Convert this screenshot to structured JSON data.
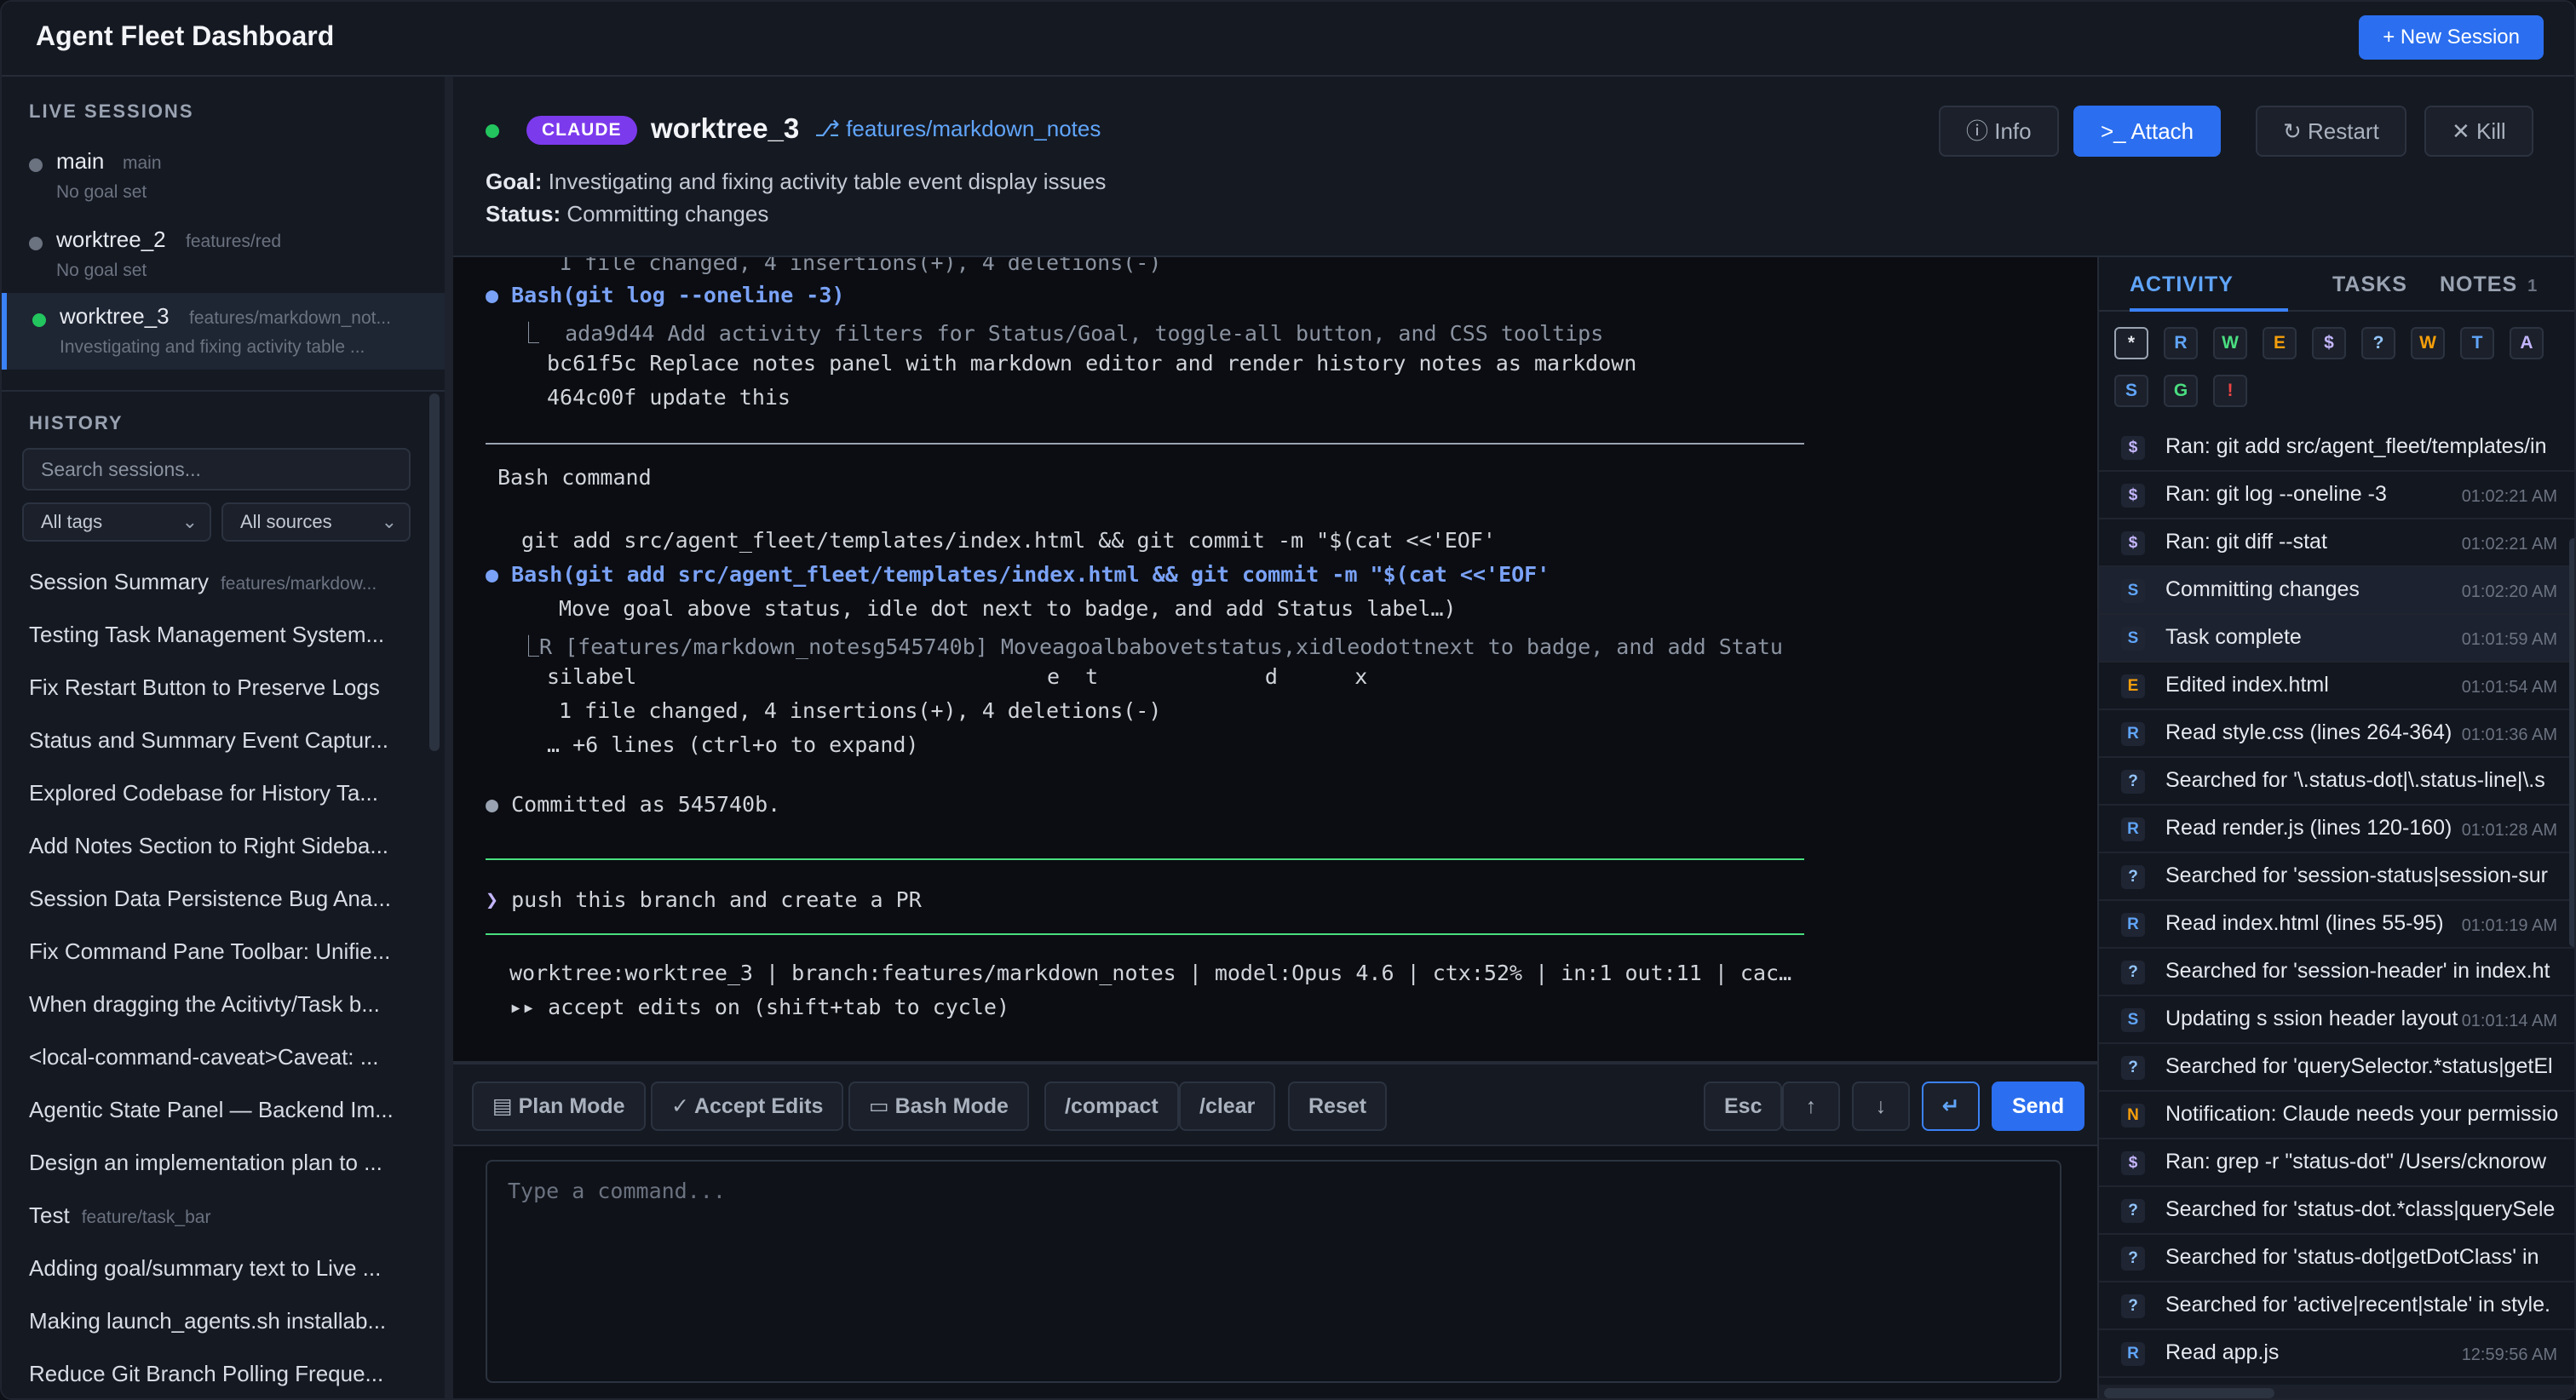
{
  "app": {
    "title": "Agent Fleet Dashboard",
    "new_session": "+ New Session"
  },
  "sidebar": {
    "live_heading": "LIVE SESSIONS",
    "live": [
      {
        "name": "main",
        "branch": "main",
        "goal": "No goal set"
      },
      {
        "name": "worktree_2",
        "branch": "features/red",
        "goal": "No goal set"
      },
      {
        "name": "worktree_3",
        "branch": "features/markdown_not...",
        "goal": "Investigating and fixing activity table ..."
      }
    ],
    "history_heading": "HISTORY",
    "search_placeholder": "Search sessions...",
    "tags_select": "All tags",
    "sources_select": "All sources",
    "history": [
      {
        "title": "Session Summary",
        "tag": "features/markdow..."
      },
      {
        "title": "Testing Task Management System...",
        "tag": ""
      },
      {
        "title": "Fix Restart Button to Preserve Logs",
        "tag": ""
      },
      {
        "title": "Status and Summary Event Captur...",
        "tag": ""
      },
      {
        "title": "Explored Codebase for History Ta...",
        "tag": ""
      },
      {
        "title": "Add Notes Section to Right Sideba...",
        "tag": ""
      },
      {
        "title": "Session Data Persistence Bug Ana...",
        "tag": ""
      },
      {
        "title": "Fix Command Pane Toolbar: Unifie...",
        "tag": ""
      },
      {
        "title": "When dragging the Acitivty/Task b...",
        "tag": ""
      },
      {
        "title": "<local-command-caveat>Caveat: ...",
        "tag": ""
      },
      {
        "title": "Agentic State Panel — Backend Im...",
        "tag": ""
      },
      {
        "title": "Design an implementation plan to ...",
        "tag": ""
      },
      {
        "title": "Test",
        "tag": "feature/task_bar"
      },
      {
        "title": "Adding goal/summary text to Live ...",
        "tag": ""
      },
      {
        "title": "Making launch_agents.sh installab...",
        "tag": ""
      },
      {
        "title": "Reduce Git Branch Polling Freque...",
        "tag": ""
      }
    ]
  },
  "session": {
    "agent_badge": "CLAUDE",
    "name": "worktree_3",
    "branch": "features/markdown_notes",
    "goal_label": "Goal:",
    "goal": "Investigating and fixing activity table event display issues",
    "status_label": "Status:",
    "status": "Committing changes",
    "buttons": {
      "info": "Info",
      "attach": "Attach",
      "restart": "Restart",
      "kill": "Kill"
    }
  },
  "terminal": {
    "lines": [
      "1 file changed, 4 insertions(+), 4 deletions(-)",
      "● ",
      "Bash(git log --oneline -3)",
      "⎿  ada9d44 Add activity filters for Status/Goal, toggle-all button, and CSS tooltips",
      "bc61f5c Replace notes panel with markdown editor and render history notes as markdown",
      "464c00f update this",
      "Bash command",
      "git add src/agent_fleet/templates/index.html && git commit -m \"$(cat <<'EOF'",
      "Bash(git add src/agent_fleet/templates/index.html && git commit -m \"$(cat <<'EOF'",
      "Move goal above status, idle dot next to badge, and add Status label…)",
      "⎿R [features/markdown_notesg545740b] Moveagoalbabovetstatus,xidleodottnext to badge, and add Statu",
      "silabel                                e  t             d      x",
      "1 file changed, 4 insertions(+), 4 deletions(-)",
      "… +6 lines (ctrl+o to expand)",
      "Committed as 545740b.",
      "push this branch and create a PR",
      "worktree:worktree_3 | branch:features/markdown_notes | model:Opus 4.6 | ctx:52% | in:1 out:11 | cac…",
      "▸▸ accept edits on (shift+tab to cycle)"
    ],
    "bullet": "●",
    "prompt_mark": "❯"
  },
  "toolbar": {
    "plan_mode": "Plan Mode",
    "accept_edits": "Accept Edits",
    "bash_mode": "Bash Mode",
    "compact": "/compact",
    "clear": "/clear",
    "reset": "Reset",
    "esc": "Esc",
    "up": "↑",
    "down": "↓",
    "enter": "↵",
    "send": "Send"
  },
  "command_input": {
    "placeholder": "Type a command..."
  },
  "right_panel": {
    "tabs": {
      "activity": "ACTIVITY",
      "tasks": "TASKS",
      "notes": "NOTES",
      "notes_count": "1"
    },
    "filters": [
      "*",
      "R",
      "W",
      "E",
      "$",
      "?",
      "W",
      "T",
      "A",
      "S",
      "G",
      "!"
    ],
    "activity": [
      {
        "icon": "$",
        "text": "Ran: git add src/agent_fleet/templates/in",
        "time": ""
      },
      {
        "icon": "$",
        "text": "Ran: git log --oneline -3",
        "time": "01:02:21 AM"
      },
      {
        "icon": "$",
        "text": "Ran: git diff --stat",
        "time": "01:02:21 AM"
      },
      {
        "icon": "S",
        "text": "Committing changes",
        "time": "01:02:20 AM"
      },
      {
        "icon": "S",
        "text": "Task complete",
        "time": "01:01:59 AM"
      },
      {
        "icon": "E",
        "text": "Edited index.html",
        "time": "01:01:54 AM"
      },
      {
        "icon": "R",
        "text": "Read style.css (lines 264-364)",
        "time": "01:01:36 AM"
      },
      {
        "icon": "?",
        "text": "Searched for '\\.status-dot|\\.status-line|\\.s",
        "time": ""
      },
      {
        "icon": "R",
        "text": "Read render.js (lines 120-160)",
        "time": "01:01:28 AM"
      },
      {
        "icon": "?",
        "text": "Searched for 'session-status|session-sur",
        "time": ""
      },
      {
        "icon": "R",
        "text": "Read index.html (lines 55-95)",
        "time": "01:01:19 AM"
      },
      {
        "icon": "?",
        "text": "Searched for 'session-header' in index.ht",
        "time": ""
      },
      {
        "icon": "S",
        "text": "Updating s ssion header layout",
        "time": "01:01:14 AM"
      },
      {
        "icon": "?",
        "text": "Searched for 'querySelector.*status|getEl",
        "time": ""
      },
      {
        "icon": "N",
        "text": "Notification: Claude needs your permissio",
        "time": ""
      },
      {
        "icon": "$",
        "text": "Ran: grep -r \"status-dot\" /Users/cknorow",
        "time": ""
      },
      {
        "icon": "?",
        "text": "Searched for 'status-dot.*class|querySele",
        "time": ""
      },
      {
        "icon": "?",
        "text": "Searched for 'status-dot|getDotClass' in",
        "time": ""
      },
      {
        "icon": "?",
        "text": "Searched for 'active|recent|stale' in style.",
        "time": ""
      },
      {
        "icon": "R",
        "text": "Read app.js",
        "time": "12:59:56 AM"
      }
    ]
  },
  "colors": {
    "accent": "#2b6ff0",
    "badge": "#7c3aed",
    "live": "#22c55e",
    "terminal_bg": "#0b0d12"
  }
}
